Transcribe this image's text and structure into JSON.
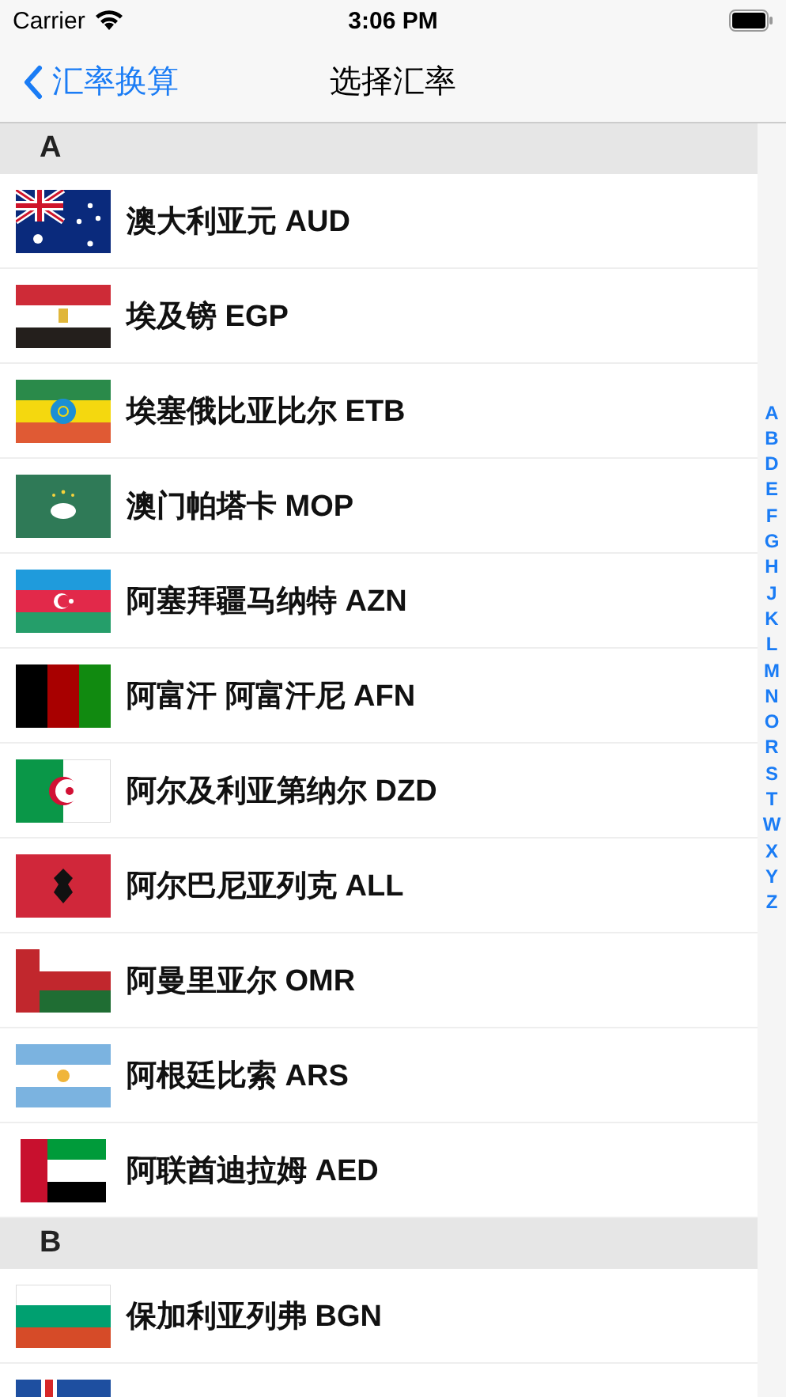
{
  "status_bar": {
    "carrier": "Carrier",
    "time": "3:06 PM"
  },
  "nav": {
    "back": "汇率换算",
    "title": "选择汇率"
  },
  "sections": [
    {
      "letter": "A",
      "rows": [
        {
          "kind": "australia",
          "name": "澳大利亚元 AUD"
        },
        {
          "kind": "egypt",
          "name": "埃及镑 EGP"
        },
        {
          "kind": "ethiopia",
          "name": "埃塞俄比亚比尔 ETB"
        },
        {
          "kind": "macau",
          "name": "澳门帕塔卡 MOP"
        },
        {
          "kind": "azerbaijan",
          "name": "阿塞拜疆马纳特 AZN"
        },
        {
          "kind": "afghanistan",
          "name": "阿富汗 阿富汗尼 AFN"
        },
        {
          "kind": "algeria",
          "name": "阿尔及利亚第纳尔 DZD"
        },
        {
          "kind": "albania",
          "name": "阿尔巴尼亚列克 ALL"
        },
        {
          "kind": "oman",
          "name": "阿曼里亚尔 OMR"
        },
        {
          "kind": "argentina",
          "name": "阿根廷比索 ARS"
        },
        {
          "kind": "uae",
          "name": "阿联酋迪拉姆 AED"
        }
      ]
    },
    {
      "letter": "B",
      "rows": [
        {
          "kind": "bulgaria",
          "name": "保加利亚列弗 BGN"
        },
        {
          "kind": "iceland"
        }
      ]
    }
  ],
  "index": [
    "A",
    "B",
    "D",
    "E",
    "F",
    "G",
    "H",
    "J",
    "K",
    "L",
    "M",
    "N",
    "O",
    "R",
    "S",
    "T",
    "W",
    "X",
    "Y",
    "Z"
  ]
}
